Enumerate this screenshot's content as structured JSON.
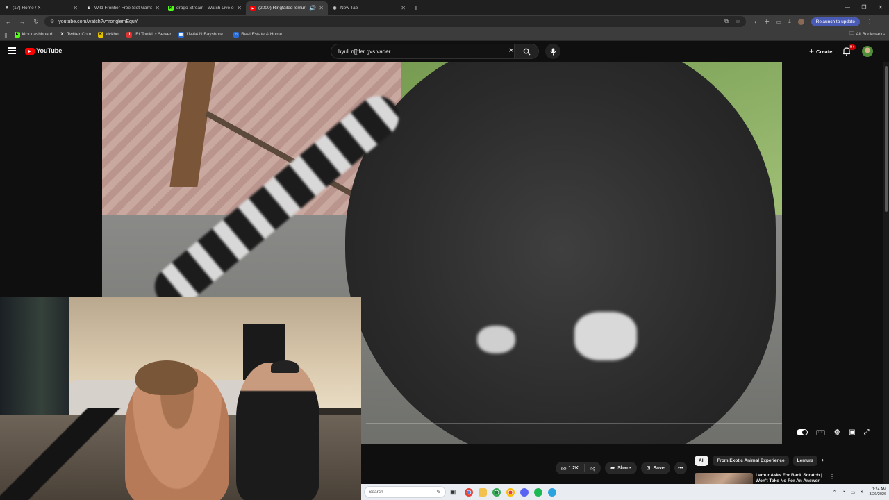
{
  "browser": {
    "tabs": [
      {
        "title": "(17) Home / X",
        "icon": "x-logo-icon",
        "fav_color": "#ffffff",
        "fav_bg": "transparent",
        "glyph": "X"
      },
      {
        "title": "Wild Frontier Free Slot Game b",
        "icon": "stake-icon",
        "fav_color": "#ffffff",
        "fav_bg": "transparent",
        "glyph": "S"
      },
      {
        "title": "drago Stream - Watch Live on K",
        "icon": "kick-icon",
        "fav_color": "#000000",
        "fav_bg": "#53fc18",
        "glyph": "K"
      },
      {
        "title": "(2000) Ringtailed lemur lov",
        "icon": "youtube-icon",
        "fav_color": "#ffffff",
        "fav_bg": "#ff0000",
        "glyph": "▶",
        "active": true
      },
      {
        "title": "New Tab",
        "icon": "chrome-icon",
        "fav_color": "#cccccc",
        "fav_bg": "transparent",
        "glyph": "◉"
      }
    ],
    "url": "youtube.com/watch?v=ronglemEquY",
    "relaunch_label": "Relaunch to update",
    "bookmarks": [
      {
        "label": "kick dashboard",
        "glyph": "K",
        "fav_bg": "#53fc18",
        "fav_color": "#000000"
      },
      {
        "label": "Twitter Com",
        "glyph": "X",
        "fav_bg": "transparent",
        "fav_color": "#ffffff"
      },
      {
        "label": "kickbot",
        "glyph": "K",
        "fav_bg": "#e6c400",
        "fav_color": "#000000"
      },
      {
        "label": "IRLToolkit • Server",
        "glyph": "I",
        "fav_bg": "#d33",
        "fav_color": "#ffffff"
      },
      {
        "label": "11404 N Bayshore...",
        "glyph": "▦",
        "fav_bg": "#2a6bd6",
        "fav_color": "#ffffff"
      },
      {
        "label": "Real Estate & Home...",
        "glyph": "⌂",
        "fav_bg": "#2a6bd6",
        "fav_color": "#ffffff"
      }
    ],
    "all_bookmarks_label": "All Bookmarks"
  },
  "youtube": {
    "logo_text": "YouTube",
    "search_value": "hyul' n[[tler gvs vader",
    "create_label": "Create",
    "notif_badge": "9+",
    "actions": {
      "like_count": "1.2K",
      "share_label": "Share",
      "save_label": "Save"
    },
    "chips": [
      "All",
      "From Exotic Animal Experience",
      "Lemurs"
    ],
    "recommendation": {
      "title": "Lemur Asks For Back Scratch | Won't Take No For An Answer"
    }
  },
  "taskbar": {
    "search_placeholder": "Search",
    "time": "1:24 AM",
    "date": "3/26/2026",
    "icons": [
      {
        "name": "chrome-icon",
        "color": "#4285f4"
      },
      {
        "name": "folder-icon",
        "color": "#f2c14e"
      },
      {
        "name": "chrome-dev-icon",
        "color": "#2b7a4b"
      },
      {
        "name": "chrome-alt-icon",
        "color": "#ea4335"
      },
      {
        "name": "discord-icon",
        "color": "#5865f2"
      },
      {
        "name": "spotify-icon",
        "color": "#1db954"
      },
      {
        "name": "telegram-icon",
        "color": "#2aa3df"
      }
    ]
  }
}
